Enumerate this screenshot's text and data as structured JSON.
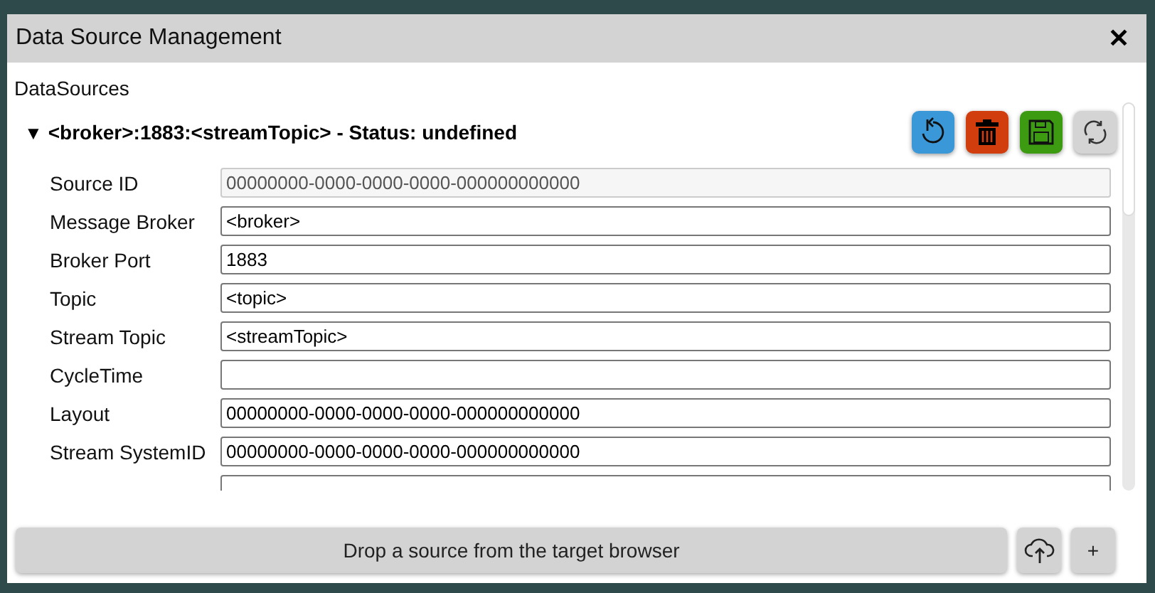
{
  "window": {
    "title": "Data Source Management",
    "close": "✕"
  },
  "section_label": "DataSources",
  "source": {
    "expanded": true,
    "toggle": "▼",
    "title": "<broker>:1883:<streamTopic> - Status: undefined",
    "actions": [
      {
        "kind": "reset",
        "color": "#3a97d8"
      },
      {
        "kind": "delete",
        "color": "#d13d0c"
      },
      {
        "kind": "save",
        "color": "#3c9b10"
      },
      {
        "kind": "refresh",
        "color": "#d4d4d4"
      }
    ],
    "fields": [
      {
        "label": "Source ID",
        "value": "00000000-0000-0000-0000-000000000000",
        "disabled": true
      },
      {
        "label": "Message Broker",
        "value": "<broker>",
        "disabled": false
      },
      {
        "label": "Broker Port",
        "value": "1883",
        "disabled": false
      },
      {
        "label": "Topic",
        "value": "<topic>",
        "disabled": false
      },
      {
        "label": "Stream Topic",
        "value": "<streamTopic>",
        "disabled": false
      },
      {
        "label": "CycleTime",
        "disabled": false
      },
      {
        "label": "Layout",
        "value": "00000000-0000-0000-0000-000000000000",
        "disabled": false
      },
      {
        "label": "Stream SystemID",
        "value": "00000000-0000-0000-0000-000000000000",
        "disabled": false
      },
      {
        "disabled": false
      }
    ]
  },
  "footer": {
    "drop_button": "Drop a source from the target browser",
    "add_button": "+"
  }
}
